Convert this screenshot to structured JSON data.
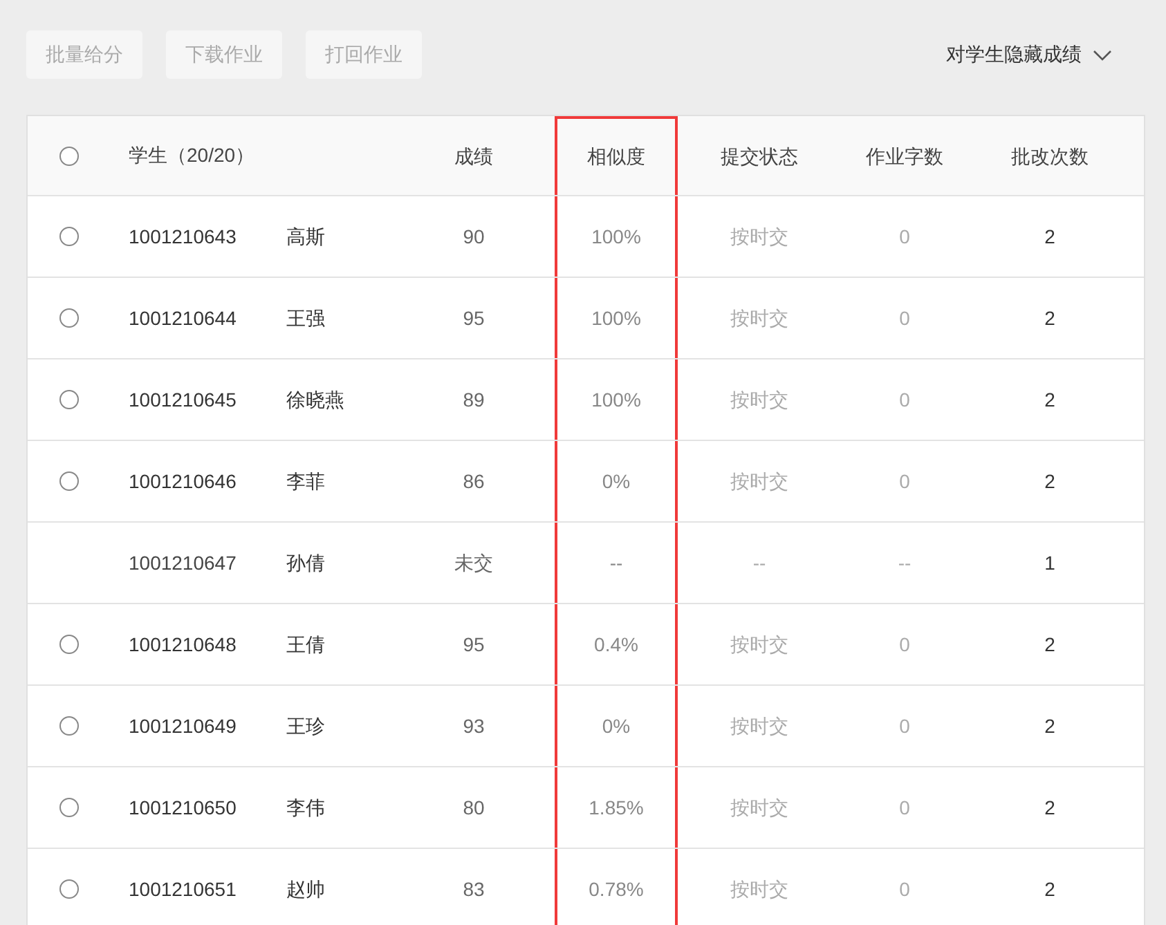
{
  "toolbar": {
    "buttons": [
      {
        "label": "批量给分",
        "disabled": true
      },
      {
        "label": "下载作业",
        "disabled": true
      },
      {
        "label": "打回作业",
        "disabled": true
      }
    ],
    "grade_visibility": {
      "label": "对学生隐藏成绩"
    }
  },
  "table": {
    "select_all": {
      "checked": false
    },
    "student_header": "学生（20/20）",
    "columns": [
      {
        "label": "成绩",
        "highlighted": false
      },
      {
        "label": "相似度",
        "highlighted": true
      },
      {
        "label": "提交状态",
        "highlighted": false
      },
      {
        "label": "作业字数",
        "highlighted": false
      },
      {
        "label": "批改次数",
        "highlighted": false
      }
    ],
    "rows": [
      {
        "kind": "submitted",
        "checked": false,
        "id": "1001210643",
        "name": "高斯",
        "cells": [
          "90",
          "100%",
          "按时交",
          "0",
          "2"
        ]
      },
      {
        "kind": "submitted",
        "checked": false,
        "id": "1001210644",
        "name": "王强",
        "cells": [
          "95",
          "100%",
          "按时交",
          "0",
          "2"
        ]
      },
      {
        "kind": "submitted",
        "checked": false,
        "id": "1001210645",
        "name": "徐晓燕",
        "cells": [
          "89",
          "100%",
          "按时交",
          "0",
          "2"
        ]
      },
      {
        "kind": "submitted",
        "checked": false,
        "id": "1001210646",
        "name": "李菲",
        "cells": [
          "86",
          "0%",
          "按时交",
          "0",
          "2"
        ]
      },
      {
        "kind": "missing",
        "id": "1001210647",
        "name": "孙倩",
        "cells": [
          "未交",
          "--",
          "--",
          "--",
          "1"
        ]
      },
      {
        "kind": "submitted",
        "checked": false,
        "id": "1001210648",
        "name": "王倩",
        "cells": [
          "95",
          "0.4%",
          "按时交",
          "0",
          "2"
        ]
      },
      {
        "kind": "submitted",
        "checked": false,
        "id": "1001210649",
        "name": "王珍",
        "cells": [
          "93",
          "0%",
          "按时交",
          "0",
          "2"
        ]
      },
      {
        "kind": "submitted",
        "checked": false,
        "id": "1001210650",
        "name": "李伟",
        "cells": [
          "80",
          "1.85%",
          "按时交",
          "0",
          "2"
        ]
      },
      {
        "kind": "submitted",
        "checked": false,
        "id": "1001210651",
        "name": "赵帅",
        "cells": [
          "83",
          "0.78%",
          "按时交",
          "0",
          "2"
        ]
      }
    ]
  }
}
